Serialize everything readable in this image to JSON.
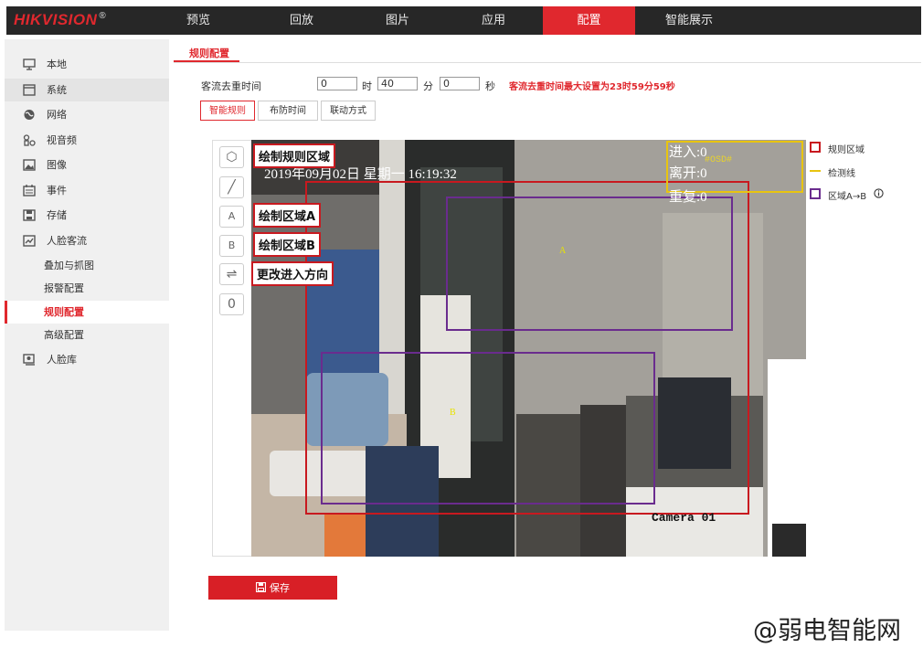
{
  "brand": {
    "logo_text": "HIKVISION",
    "reg_mark": "®",
    "accent": "#e0282e"
  },
  "nav": {
    "tabs": [
      "预览",
      "回放",
      "图片",
      "应用",
      "配置",
      "智能展示"
    ],
    "active_index": 4
  },
  "sidebar": {
    "items": [
      {
        "label": "本地",
        "icon": "monitor-icon"
      },
      {
        "label": "系统",
        "icon": "system-icon"
      },
      {
        "label": "网络",
        "icon": "globe-icon"
      },
      {
        "label": "视音频",
        "icon": "av-icon"
      },
      {
        "label": "图像",
        "icon": "image-icon"
      },
      {
        "label": "事件",
        "icon": "calendar-icon"
      },
      {
        "label": "存储",
        "icon": "storage-icon"
      },
      {
        "label": "人脸客流",
        "icon": "face-flow-icon"
      },
      {
        "label": "叠加与抓图",
        "sub": true
      },
      {
        "label": "报警配置",
        "sub": true
      },
      {
        "label": "规则配置",
        "sub": true,
        "selected": true
      },
      {
        "label": "高级配置",
        "sub": true
      },
      {
        "label": "人脸库",
        "icon": "face-db-icon"
      }
    ]
  },
  "page": {
    "breadcrumb": "规则配置",
    "dedup_label": "客流去重时间",
    "hours_value": "0",
    "hours_unit": "时",
    "minutes_value": "40",
    "minutes_unit": "分",
    "seconds_value": "0",
    "seconds_unit": "秒",
    "hint": "客流去重时间最大设置为23时59分59秒",
    "subtabs": [
      "智能规则",
      "布防时间",
      "联动方式"
    ],
    "active_subtab": 0
  },
  "tools": [
    {
      "name": "polygon-icon",
      "glyph": "⬡"
    },
    {
      "name": "line-icon",
      "glyph": "╱"
    },
    {
      "name": "region-a-icon",
      "glyph": "A"
    },
    {
      "name": "region-b-icon",
      "glyph": "B"
    },
    {
      "name": "swap-direction-icon",
      "glyph": "⇌"
    },
    {
      "name": "reset-icon",
      "glyph": "0"
    }
  ],
  "callouts": [
    "绘制规则区域",
    "绘制区域A",
    "绘制区域B",
    "更改进入方向"
  ],
  "video": {
    "timestamp": "2019年09月02日 星期一 16:19:32",
    "enter": "进入:0",
    "leave": "离开:0",
    "repeat": "重复:0",
    "osd": "#OSD#",
    "camera": "Camera 01",
    "region_a_label": "A",
    "region_b_label": "B"
  },
  "legend": [
    {
      "label": "规则区域",
      "color": "#c8191f",
      "kind": "square"
    },
    {
      "label": "检测线",
      "color": "#e8c410",
      "kind": "line"
    },
    {
      "label": "区域A→B",
      "color": "#6a2c8e",
      "kind": "square",
      "info_icon": "info-icon"
    }
  ],
  "save": {
    "label": "保存",
    "icon": "save-icon"
  },
  "watermark": "@弱电智能网"
}
